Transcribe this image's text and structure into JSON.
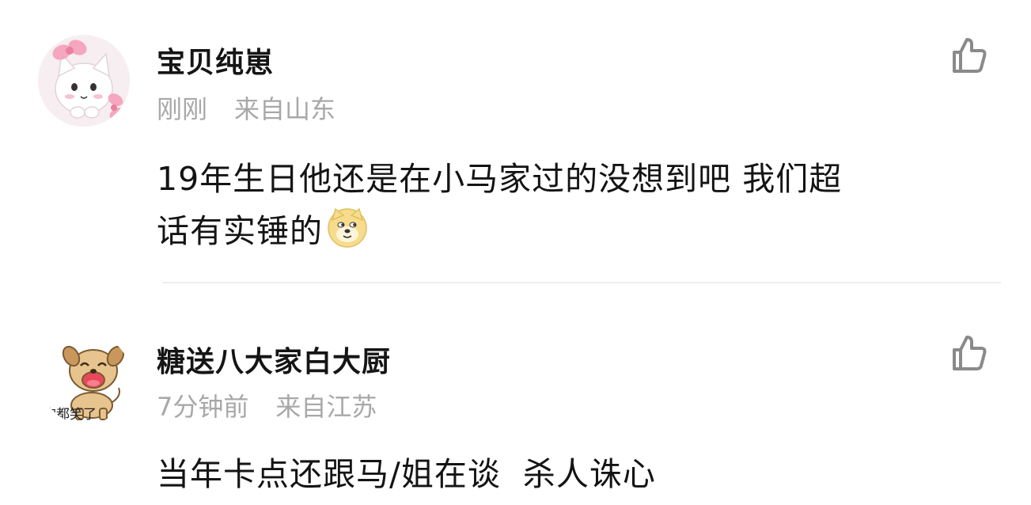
{
  "comments": [
    {
      "username": "宝贝纯崽",
      "time": "刚刚",
      "location": "来自山东",
      "text_line1": "19年生日他还是在小马家过的没想到吧 我们超",
      "text_line2": "话有实锤的",
      "emoji": "doge-emoji",
      "avatar": "pink-bow-kitten-avatar"
    },
    {
      "username": "糖送八大家白大厨",
      "time": "7分钟前",
      "location": "来自江苏",
      "text_line1": "当年卡点还跟马/姐在谈  杀人诛心",
      "avatar": "laughing-dog-avatar",
      "avatar_caption": "狗都笑了"
    }
  ],
  "colors": {
    "username": "#151515",
    "meta": "#a8a8a8",
    "body_text": "#141414",
    "icon_gray": "#8a8a8a",
    "divider": "#eeeeee"
  },
  "icons": {
    "like": "thumbs-up-outline-icon"
  }
}
